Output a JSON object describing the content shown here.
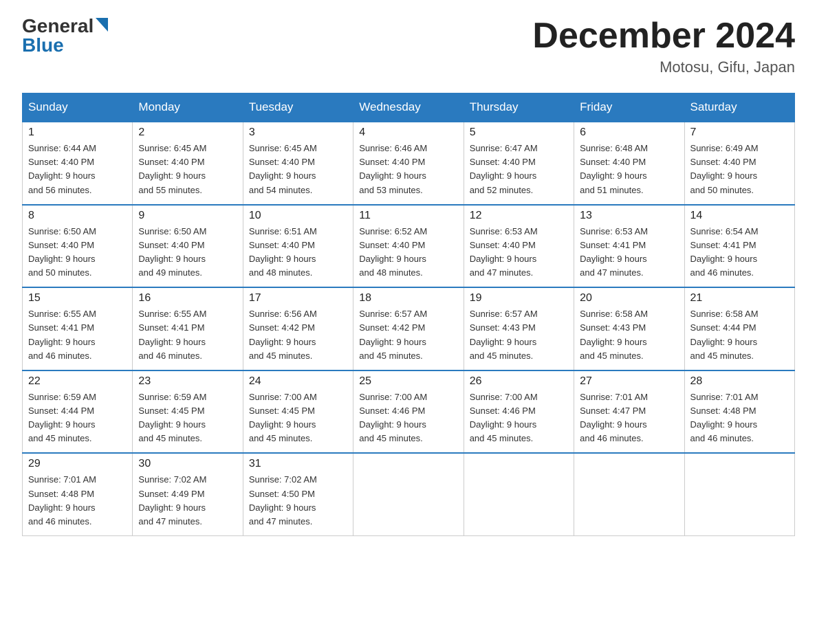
{
  "logo": {
    "general": "General",
    "blue": "Blue"
  },
  "title": {
    "month": "December 2024",
    "location": "Motosu, Gifu, Japan"
  },
  "weekdays": [
    "Sunday",
    "Monday",
    "Tuesday",
    "Wednesday",
    "Thursday",
    "Friday",
    "Saturday"
  ],
  "weeks": [
    [
      {
        "day": "1",
        "sunrise": "6:44 AM",
        "sunset": "4:40 PM",
        "daylight": "9 hours and 56 minutes."
      },
      {
        "day": "2",
        "sunrise": "6:45 AM",
        "sunset": "4:40 PM",
        "daylight": "9 hours and 55 minutes."
      },
      {
        "day": "3",
        "sunrise": "6:45 AM",
        "sunset": "4:40 PM",
        "daylight": "9 hours and 54 minutes."
      },
      {
        "day": "4",
        "sunrise": "6:46 AM",
        "sunset": "4:40 PM",
        "daylight": "9 hours and 53 minutes."
      },
      {
        "day": "5",
        "sunrise": "6:47 AM",
        "sunset": "4:40 PM",
        "daylight": "9 hours and 52 minutes."
      },
      {
        "day": "6",
        "sunrise": "6:48 AM",
        "sunset": "4:40 PM",
        "daylight": "9 hours and 51 minutes."
      },
      {
        "day": "7",
        "sunrise": "6:49 AM",
        "sunset": "4:40 PM",
        "daylight": "9 hours and 50 minutes."
      }
    ],
    [
      {
        "day": "8",
        "sunrise": "6:50 AM",
        "sunset": "4:40 PM",
        "daylight": "9 hours and 50 minutes."
      },
      {
        "day": "9",
        "sunrise": "6:50 AM",
        "sunset": "4:40 PM",
        "daylight": "9 hours and 49 minutes."
      },
      {
        "day": "10",
        "sunrise": "6:51 AM",
        "sunset": "4:40 PM",
        "daylight": "9 hours and 48 minutes."
      },
      {
        "day": "11",
        "sunrise": "6:52 AM",
        "sunset": "4:40 PM",
        "daylight": "9 hours and 48 minutes."
      },
      {
        "day": "12",
        "sunrise": "6:53 AM",
        "sunset": "4:40 PM",
        "daylight": "9 hours and 47 minutes."
      },
      {
        "day": "13",
        "sunrise": "6:53 AM",
        "sunset": "4:41 PM",
        "daylight": "9 hours and 47 minutes."
      },
      {
        "day": "14",
        "sunrise": "6:54 AM",
        "sunset": "4:41 PM",
        "daylight": "9 hours and 46 minutes."
      }
    ],
    [
      {
        "day": "15",
        "sunrise": "6:55 AM",
        "sunset": "4:41 PM",
        "daylight": "9 hours and 46 minutes."
      },
      {
        "day": "16",
        "sunrise": "6:55 AM",
        "sunset": "4:41 PM",
        "daylight": "9 hours and 46 minutes."
      },
      {
        "day": "17",
        "sunrise": "6:56 AM",
        "sunset": "4:42 PM",
        "daylight": "9 hours and 45 minutes."
      },
      {
        "day": "18",
        "sunrise": "6:57 AM",
        "sunset": "4:42 PM",
        "daylight": "9 hours and 45 minutes."
      },
      {
        "day": "19",
        "sunrise": "6:57 AM",
        "sunset": "4:43 PM",
        "daylight": "9 hours and 45 minutes."
      },
      {
        "day": "20",
        "sunrise": "6:58 AM",
        "sunset": "4:43 PM",
        "daylight": "9 hours and 45 minutes."
      },
      {
        "day": "21",
        "sunrise": "6:58 AM",
        "sunset": "4:44 PM",
        "daylight": "9 hours and 45 minutes."
      }
    ],
    [
      {
        "day": "22",
        "sunrise": "6:59 AM",
        "sunset": "4:44 PM",
        "daylight": "9 hours and 45 minutes."
      },
      {
        "day": "23",
        "sunrise": "6:59 AM",
        "sunset": "4:45 PM",
        "daylight": "9 hours and 45 minutes."
      },
      {
        "day": "24",
        "sunrise": "7:00 AM",
        "sunset": "4:45 PM",
        "daylight": "9 hours and 45 minutes."
      },
      {
        "day": "25",
        "sunrise": "7:00 AM",
        "sunset": "4:46 PM",
        "daylight": "9 hours and 45 minutes."
      },
      {
        "day": "26",
        "sunrise": "7:00 AM",
        "sunset": "4:46 PM",
        "daylight": "9 hours and 45 minutes."
      },
      {
        "day": "27",
        "sunrise": "7:01 AM",
        "sunset": "4:47 PM",
        "daylight": "9 hours and 46 minutes."
      },
      {
        "day": "28",
        "sunrise": "7:01 AM",
        "sunset": "4:48 PM",
        "daylight": "9 hours and 46 minutes."
      }
    ],
    [
      {
        "day": "29",
        "sunrise": "7:01 AM",
        "sunset": "4:48 PM",
        "daylight": "9 hours and 46 minutes."
      },
      {
        "day": "30",
        "sunrise": "7:02 AM",
        "sunset": "4:49 PM",
        "daylight": "9 hours and 47 minutes."
      },
      {
        "day": "31",
        "sunrise": "7:02 AM",
        "sunset": "4:50 PM",
        "daylight": "9 hours and 47 minutes."
      },
      null,
      null,
      null,
      null
    ]
  ],
  "labels": {
    "sunrise": "Sunrise:",
    "sunset": "Sunset:",
    "daylight": "Daylight:"
  }
}
